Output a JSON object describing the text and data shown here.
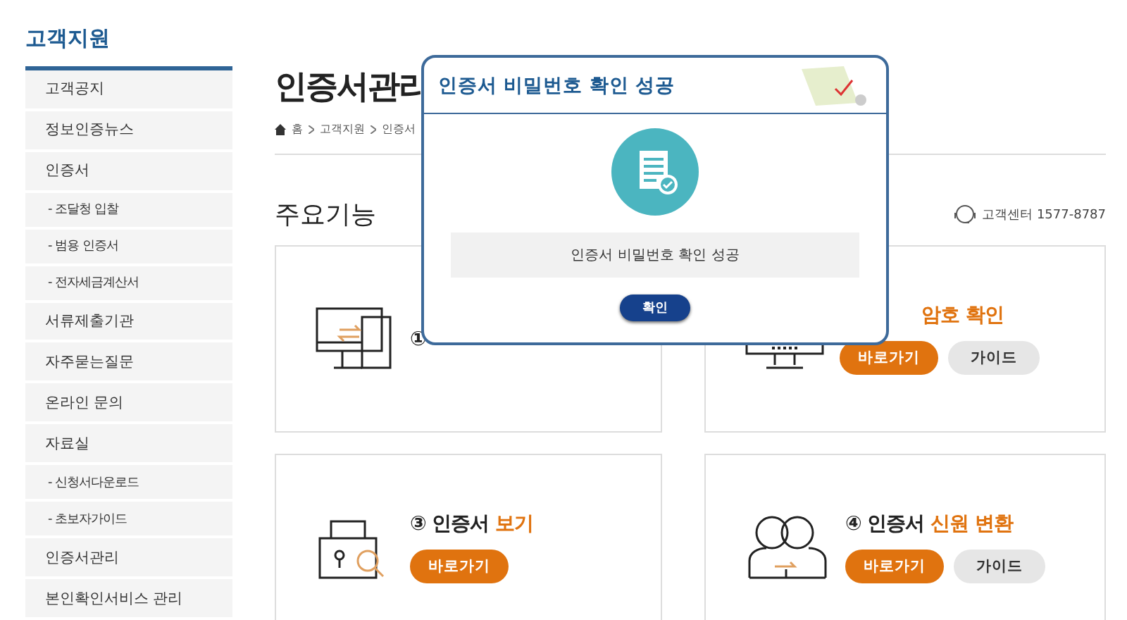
{
  "sidebar": {
    "title": "고객지원",
    "items": [
      {
        "label": "고객공지",
        "kind": "main"
      },
      {
        "label": "정보인증뉴스",
        "kind": "main"
      },
      {
        "label": "인증서",
        "kind": "main"
      },
      {
        "label": "- 조달청 입찰",
        "kind": "sub"
      },
      {
        "label": "- 범용 인증서",
        "kind": "sub"
      },
      {
        "label": "- 전자세금계산서",
        "kind": "sub"
      },
      {
        "label": "서류제출기관",
        "kind": "main"
      },
      {
        "label": "자주묻는질문",
        "kind": "main"
      },
      {
        "label": "온라인 문의",
        "kind": "main"
      },
      {
        "label": "자료실",
        "kind": "main"
      },
      {
        "label": "- 신청서다운로드",
        "kind": "sub"
      },
      {
        "label": "- 초보자가이드",
        "kind": "sub"
      },
      {
        "label": "인증서관리",
        "kind": "main"
      },
      {
        "label": "본인확인서비스 관리",
        "kind": "main"
      }
    ]
  },
  "page": {
    "title": "인증서관리",
    "breadcrumb": [
      "홈",
      "고객지원",
      "인증서"
    ]
  },
  "section": {
    "title": "주요기능",
    "contact": "고객센터 1577-8787"
  },
  "cards": [
    {
      "kind": "transfer",
      "title": "①"
    },
    {
      "kind": "password",
      "highlight": "암호 확인",
      "buttons": [
        {
          "label": "바로가기",
          "kind": "primary"
        },
        {
          "label": "가이드",
          "kind": "secondary"
        }
      ]
    },
    {
      "kind": "view",
      "title": "③ 인증서",
      "highlight": "보기",
      "buttons": [
        {
          "label": "바로가기",
          "kind": "primary"
        }
      ]
    },
    {
      "kind": "convert",
      "title": "④ 인증서",
      "highlight": "신원 변환",
      "buttons": [
        {
          "label": "바로가기",
          "kind": "primary"
        },
        {
          "label": "가이드",
          "kind": "secondary"
        }
      ]
    }
  ],
  "dialog": {
    "title": "인증서 비밀번호 확인 성공",
    "message": "인증서 비밀번호 확인 성공",
    "button": "확인"
  }
}
